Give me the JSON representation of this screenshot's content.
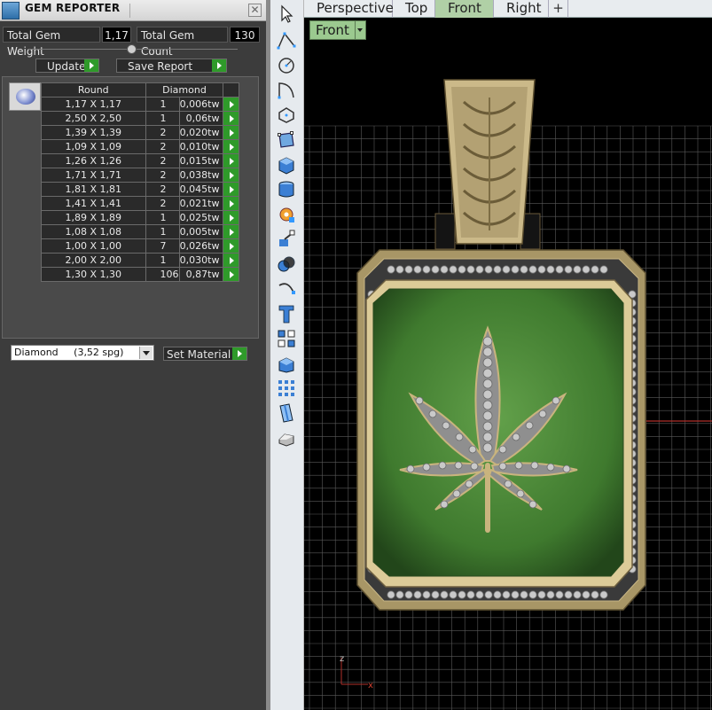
{
  "panel": {
    "title": "GEM REPORTER",
    "close_glyph": "✕",
    "total_weight_label": "Total Gem Weight",
    "total_weight_value": "1,17",
    "total_count_label": "Total Gem Count",
    "total_count_value": "130",
    "update_label": "Update",
    "save_report_label": "Save Report",
    "table_header": {
      "shape": "Round",
      "material": "Diamond"
    },
    "rows": [
      {
        "size": "1,17 X 1,17",
        "count": "1",
        "weight": "0,006tw"
      },
      {
        "size": "2,50 X 2,50",
        "count": "1",
        "weight": "0,06tw"
      },
      {
        "size": "1,39 X 1,39",
        "count": "2",
        "weight": "0,020tw"
      },
      {
        "size": "1,09 X 1,09",
        "count": "2",
        "weight": "0,010tw"
      },
      {
        "size": "1,26 X 1,26",
        "count": "2",
        "weight": "0,015tw"
      },
      {
        "size": "1,71 X 1,71",
        "count": "2",
        "weight": "0,038tw"
      },
      {
        "size": "1,81 X 1,81",
        "count": "2",
        "weight": "0,045tw"
      },
      {
        "size": "1,41 X 1,41",
        "count": "2",
        "weight": "0,021tw"
      },
      {
        "size": "1,89 X 1,89",
        "count": "1",
        "weight": "0,025tw"
      },
      {
        "size": "1,08 X 1,08",
        "count": "1",
        "weight": "0,005tw"
      },
      {
        "size": "1,00 X 1,00",
        "count": "7",
        "weight": "0,026tw"
      },
      {
        "size": "2,00 X 2,00",
        "count": "1",
        "weight": "0,030tw"
      },
      {
        "size": "1,30 X 1,30",
        "count": "106",
        "weight": "0,87tw"
      }
    ],
    "material_select": "Diamond     (3,52 spg)",
    "set_material_label": "Set Material"
  },
  "toolbar": {
    "icons": [
      "select-arrow-icon",
      "polyline-icon",
      "circle-icon",
      "arc-icon",
      "polygon-icon",
      "deform-icon",
      "box-icon",
      "cylinder-icon",
      "gear-icon",
      "transform-icon",
      "boolean-icon",
      "curve-icon",
      "text-icon",
      "array-icon",
      "extrude-icon",
      "grid-icon",
      "surface-icon",
      "solid-icon"
    ]
  },
  "viewport": {
    "tabs": [
      "Perspective",
      "Top",
      "Front",
      "Right"
    ],
    "active_tab": "Front",
    "add_tab": "+",
    "view_label": "Front",
    "axis_z": "z",
    "axis_x": "x"
  },
  "colors": {
    "panel_bg": "#3c3c3c",
    "action_green": "#2f9a2a",
    "gold": "#d2c08e",
    "enamel_green": "#4f8a3a",
    "active_tab": "#b0d0a6"
  }
}
